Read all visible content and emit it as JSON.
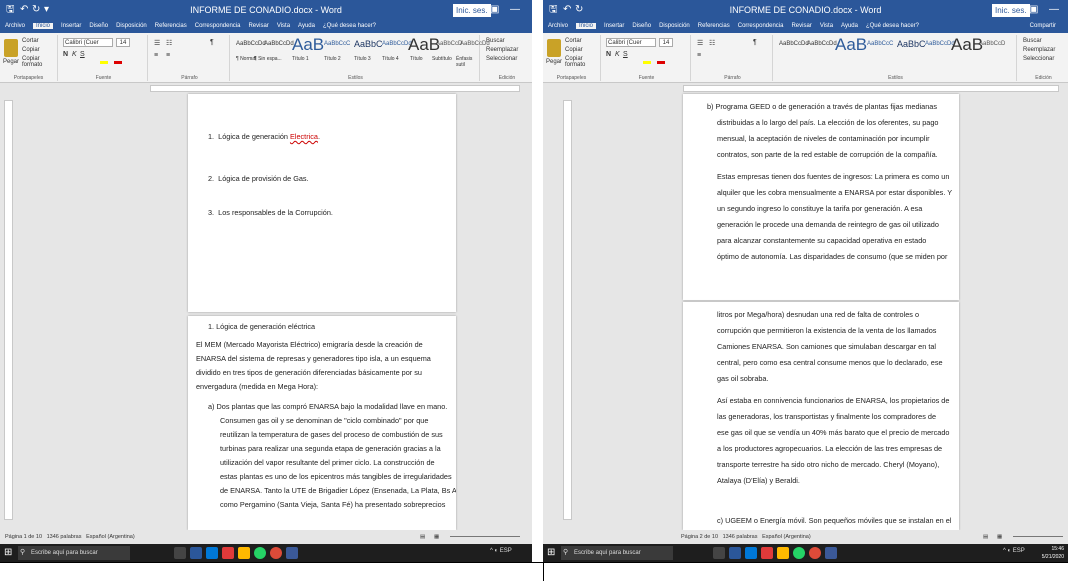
{
  "left": {
    "title": "INFORME DE CONADIO.docx  -  Word",
    "sesion": "Inic. ses.",
    "tabs": [
      "Archivo",
      "Inicio",
      "Insertar",
      "Diseño",
      "Disposición",
      "Referencias",
      "Correspondencia",
      "Revisar",
      "Vista",
      "Ayuda",
      "¿Qué desea hacer?"
    ],
    "clipboard": [
      "Cortar",
      "Copiar",
      "Copiar formato",
      "Pegar"
    ],
    "font": "Calibri (Cuer",
    "size": "14",
    "styles": [
      "AaBbCcDd",
      "AaBbCcDd",
      "AaB",
      "AaBbCcC",
      "AaBbC",
      "AaBbCcDd",
      "AaB",
      "AaBbCcD",
      "AaBbCcDd"
    ],
    "style_names": [
      "¶ Normal",
      "¶ Sin espa...",
      "Título 1",
      "Título 2",
      "Título 3",
      "Título 4",
      "Título",
      "Subtítulo",
      "Énfasis sutil"
    ],
    "edit": [
      "Buscar",
      "Reemplazar",
      "Seleccionar"
    ],
    "groups": [
      "Portapapeles",
      "Fuente",
      "Párrafo",
      "Estilos",
      "Edición"
    ],
    "status": {
      "page": "Página 1 de 10",
      "words": "1346 palabras",
      "lang": "Español (Argentina)"
    },
    "search": "Escribe aquí para buscar",
    "page1": [
      {
        "num": "1.",
        "text": "Lógica de generación ",
        "err": "Electrica",
        "tail": "."
      },
      {
        "num": "2.",
        "text": "Lógica de provisión de Gas.",
        "err": "",
        "tail": ""
      },
      {
        "num": "3.",
        "text": "Los responsables de la Corrupción.",
        "err": "",
        "tail": ""
      }
    ],
    "heading2": "1.  Lógica de generación eléctrica",
    "para": [
      "El MEM (Mercado Mayorista Eléctrico) emigraría desde la creación de",
      "ENARSA del sistema de represas y generadores tipo isla, a un esquema",
      "dividido en tres tipos de generación diferenciadas básicamente por su",
      "envergadura (medida en Mega Hora):"
    ],
    "item_a": [
      "a)  Dos plantas que las compró ENARSA bajo la modalidad llave en mano.",
      "Consumen gas oil y se denominan de \"ciclo combinado\" por que",
      "reutilizan la temperatura de gases del proceso de combustión de sus",
      "turbinas para realizar una segunda etapa de generación gracias a la",
      "utilización del vapor resultante del primer ciclo. La construcción de",
      "estas plantas es uno de los epicentros más tangibles de irregularidades",
      "de ENARSA. Tanto la UTE de Brigadier López (Ensenada, La Plata, Bs As)",
      "como Pergamino (Santa Vieja, Santa Fé) ha presentado sobreprecios"
    ]
  },
  "right": {
    "title": "INFORME DE CONADIO.docx  -  Word",
    "sesion": "Inic. ses.",
    "tabs": [
      "Archivo",
      "Inicio",
      "Insertar",
      "Diseño",
      "Disposición",
      "Referencias",
      "Correspondencia",
      "Revisar",
      "Vista",
      "Ayuda",
      "¿Qué desea hacer?"
    ],
    "share": "Compartir",
    "status": {
      "page": "Página 2 de 10",
      "words": "1346 palabras",
      "lang": "Español (Argentina)"
    },
    "search": "Escribe aquí para buscar",
    "clock": "15:46",
    "date": "5/21/2020",
    "item_b": [
      "b)  Programa GEED o de generación a través de plantas fijas medianas",
      "distribuidas a lo largo del país. La elección de los oferentes, su pago",
      "mensual, la aceptación de niveles de contaminación por incumplir",
      "contratos, son parte de la red estable de corrupción de la compañía."
    ],
    "para2": [
      "Estas empresas tienen dos fuentes de ingresos: La primera es como un",
      "alquiler que les cobra mensualmente a ENARSA por estar disponibles. Y",
      "un segundo ingreso lo constituye la tarifa por generación. A esa",
      "generación le procede una demanda de reintegro de gas oil utilizado",
      "para alcanzar constantemente su capacidad operativa en estado",
      "óptimo de autonomía. Las disparidades de consumo (que se miden por"
    ],
    "para3": [
      "litros por Mega/hora) desnudan una red de falta de controles o",
      "corrupción que permitieron la existencia de la venta de los llamados",
      "Camiones ENARSA. Son camiones que simulaban descargar en tal",
      "central, pero como esa central consume menos que lo declarado, ese",
      "gas oil sobraba."
    ],
    "para4": [
      "Así estaba en connivencia funcionarios de ENARSA, los propietarios de",
      "las generadoras, los transportistas y finalmente los compradores de",
      "ese gas oil que se vendía un 40% más barato que el precio de mercado",
      "a los productores agropecuarios. La elección de las tres empresas de",
      "transporte terrestre ha sido otro nicho de mercado. Cheryl (Moyano),",
      "Atalaya (D'Elía) y Beraldi."
    ],
    "item_c": "c)  UGEEM o Energía móvil.  Son pequeños móviles que se instalan en el"
  }
}
